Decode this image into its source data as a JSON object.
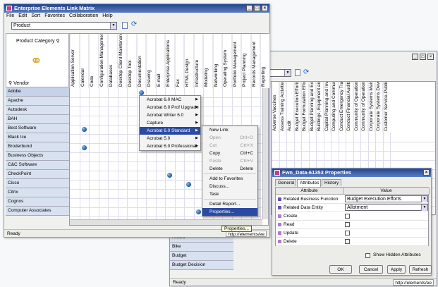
{
  "win1": {
    "title": "Enterprise Elements Link Matrix",
    "menu": [
      "File",
      "Edit",
      "Sort",
      "Favorites",
      "Collaboration",
      "Help"
    ],
    "combo": "Product",
    "corner_top": "Product Category",
    "corner_bottom": "Vendor",
    "status": "Ready",
    "columns": [
      "Application Server",
      "Calendar",
      "Code",
      "Configuration Management",
      "Databases",
      "Desktop Client Maintenance",
      "Desktop Tool",
      "Documentation",
      "Drawing",
      "E-mail",
      "Enterprise Applications",
      "Fax",
      "HTML Design",
      "Infrastructure",
      "Modeling",
      "Networking",
      "Operating System",
      "Portfolio Management",
      "Project Planning",
      "Records Management",
      "Reporting"
    ],
    "rows": [
      "Adobe",
      "Apache",
      "Autodesk",
      "BAH",
      "Best Software",
      "Black Ice",
      "Broderbund",
      "Business Objects",
      "C&C Software",
      "CheckPoint",
      "Cisco",
      "Citrix",
      "Cognos",
      "Computer Associates"
    ]
  },
  "menu1": [
    "Acrobat 6.0 MAC",
    "Acrobat 6.0 Prof Upgrade",
    "Acrobat Writer 6.0",
    "Capture",
    "Acrobat 6.0 Standard",
    "Acrobat 5.0",
    "Acrobat 6.0 Professional"
  ],
  "menu2": [
    {
      "label": "New Link",
      "sc": ""
    },
    {
      "label": "Open",
      "sc": "Ctrl+O"
    },
    {
      "label": "Cut",
      "sc": "Ctrl+X"
    },
    {
      "label": "Copy",
      "sc": "Ctrl+C"
    },
    {
      "label": "Paste",
      "sc": "Ctrl+V"
    },
    {
      "label": "Delete",
      "sc": "Delete"
    },
    {
      "label": "Add to Favorites",
      "sc": ""
    },
    {
      "label": "Discuss...",
      "sc": ""
    },
    {
      "label": "Task",
      "sc": ""
    },
    {
      "label": "Detail Report...",
      "sc": ""
    },
    {
      "label": "Properties...",
      "sc": ""
    }
  ],
  "tooltip": "Properties...",
  "win2": {
    "columns": [
      "Adverse Vaccines",
      "Assess Training Activities",
      "Audit",
      "Budget Execution Efforts",
      "Budget Formulation Efforts",
      "Budget Planning and Execu...",
      "Buildings, Equipment and F...",
      "Capital Planning and Invest...",
      "Computing and Communicat...",
      "Conduct Emergency Trainin...",
      "Conduct Financial Audits a...",
      "Community of Operations-Alam...",
      "Community of Operations-IT",
      "Corporate Systems Mainten...",
      "Corporate Systems Develo...",
      "Customer Service-Public"
    ],
    "rows": [
      "Award",
      "Bike",
      "Budget",
      "Budget Decision"
    ],
    "status": "Ready",
    "url": "http://elements/ee"
  },
  "win1_url": "http://elements/ee",
  "props": {
    "title": "Fwn_Data-61353 Properties",
    "tabs": [
      "General",
      "Attributes",
      "History"
    ],
    "headers": [
      "Attribute",
      "Value"
    ],
    "rows": [
      {
        "attr": "Related Business Function",
        "value": "Budget Execution Efforts"
      },
      {
        "attr": "Related Data Entity",
        "value": "Allotment"
      },
      {
        "attr": "Create",
        "value": ""
      },
      {
        "attr": "Read",
        "value": ""
      },
      {
        "attr": "Update",
        "value": ""
      },
      {
        "attr": "Delete",
        "value": ""
      }
    ],
    "show_hidden": "Show Hidden Attributes",
    "buttons": [
      "OK",
      "Cancel",
      "Apply",
      "Refresh"
    ]
  }
}
